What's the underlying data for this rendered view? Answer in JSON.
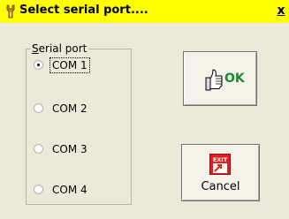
{
  "window": {
    "title": "Select serial port....",
    "close_label": "x"
  },
  "group": {
    "legend_prefix": "S",
    "legend_rest": "erial port"
  },
  "ports": [
    {
      "label": "COM 1",
      "checked": true
    },
    {
      "label": "COM 2",
      "checked": false
    },
    {
      "label": "COM 3",
      "checked": false
    },
    {
      "label": "COM 4",
      "checked": false
    }
  ],
  "buttons": {
    "ok_label": "OK",
    "exit_icon_text": "EXIT",
    "cancel_label": "Cancel"
  },
  "icons": {
    "title": "dialog-icon",
    "ok": "thumbs-up-icon",
    "cancel": "exit-sign-icon"
  },
  "colors": {
    "titlebar": "#ffff00",
    "dialog_bg": "#ece9d8",
    "ok_text": "#168a2e",
    "exit_red": "#e0201e"
  }
}
